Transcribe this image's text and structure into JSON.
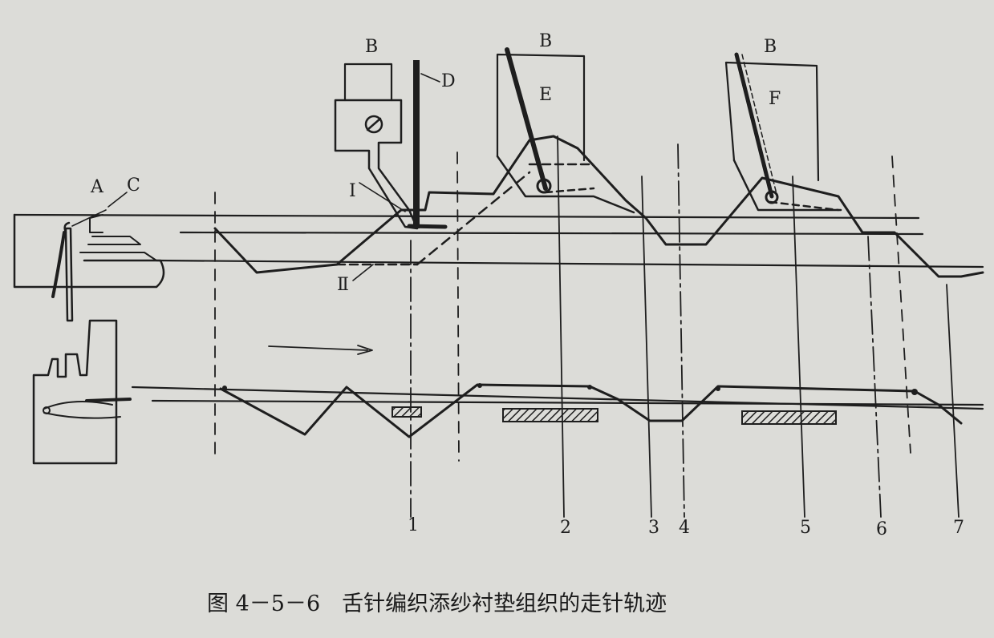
{
  "labels": {
    "A": "A",
    "C": "C",
    "B1": "B",
    "B2": "B",
    "B3": "B",
    "D": "D",
    "E": "E",
    "F": "F",
    "I": "I",
    "II": "Ⅱ"
  },
  "positions": [
    "1",
    "2",
    "3",
    "4",
    "5",
    "6",
    "7"
  ],
  "caption": "图 4－5－6　舌针编织添纱衬垫组织的走针轨迹"
}
